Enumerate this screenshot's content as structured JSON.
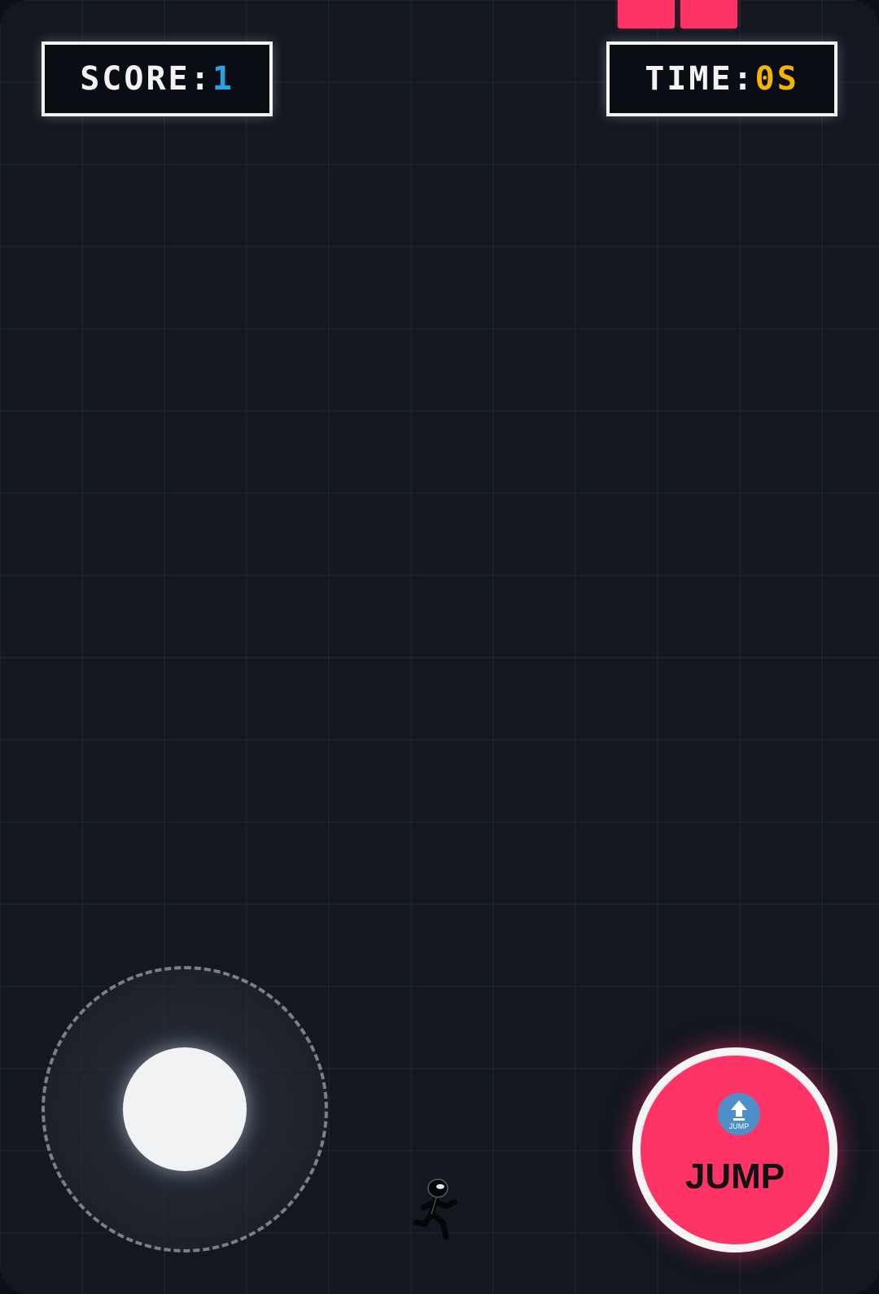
{
  "colors": {
    "background": "#121720",
    "grid": "#2a3440",
    "block": "#ff3466",
    "score_value": "#29a3e0",
    "time_value": "#f5b400",
    "hud_border": "#f2f2f2",
    "jump_button": "#ff3466",
    "jump_icon": "#4e8fc8"
  },
  "hud": {
    "score_label": "SCORE: ",
    "score_value": "1",
    "time_label": "TIME: ",
    "time_value": "0S"
  },
  "obstacles": {
    "icon": "pink-block",
    "count": 2
  },
  "joystick": {
    "icon": "virtual-joystick"
  },
  "player": {
    "icon": "running-stick-figure"
  },
  "jump_button": {
    "label": "JUMP",
    "icon_text": "JUMP",
    "icon": "up-arrow-icon"
  }
}
